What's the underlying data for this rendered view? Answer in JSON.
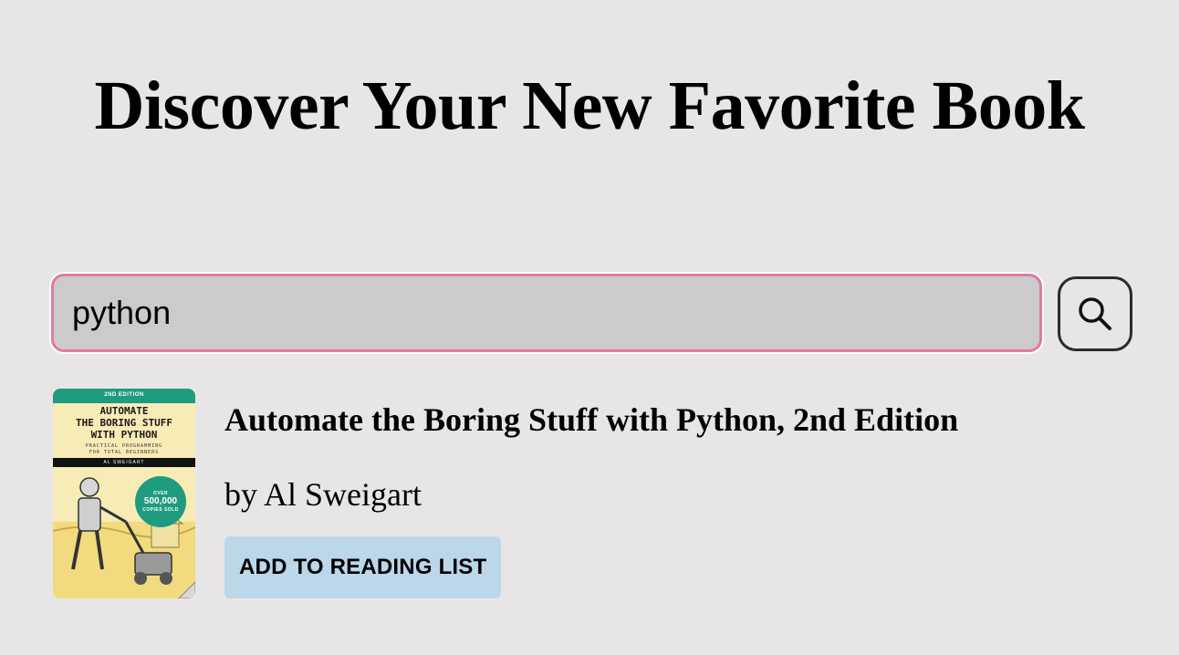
{
  "header": {
    "title": "Discover Your New Favorite Book"
  },
  "search": {
    "value": "python",
    "button_icon": "search-icon",
    "focus_border_color": "#e07aa6"
  },
  "results": [
    {
      "title": "Automate the Boring Stuff with Python, 2nd Edition",
      "author_line": "by Al Sweigart",
      "button_label": "ADD TO READING LIST",
      "cover": {
        "edition": "2ND EDITION",
        "title_lines": [
          "AUTOMATE",
          "THE BORING STUFF",
          "WITH PYTHON"
        ],
        "subtitle_lines": [
          "PRACTICAL PROGRAMMING",
          "FOR TOTAL BEGINNERS"
        ],
        "author": "AL SWEIGART",
        "badge_top": "OVER",
        "badge_main": "500,000",
        "badge_bottom": "COPIES SOLD"
      }
    }
  ],
  "colors": {
    "background": "#e7e5e6",
    "input_background": "#cbcbcb",
    "button_background": "#bcd6ea"
  }
}
